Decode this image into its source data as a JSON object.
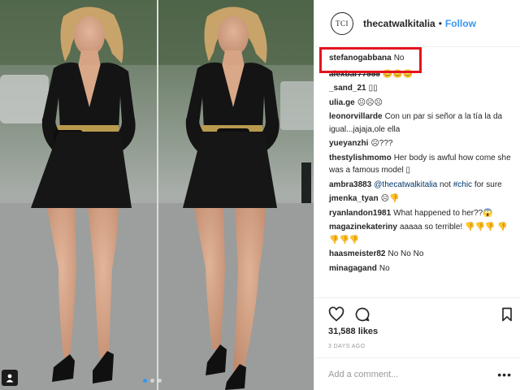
{
  "post": {
    "account": {
      "avatar_text": "TCI",
      "username": "thecatwalkitalia",
      "separator": "•",
      "follow_label": "Follow"
    },
    "comments": [
      {
        "user": "stefanogabbana",
        "text": "No",
        "highlighted": true
      },
      {
        "user": "alexbar77555",
        "text": "😊😊😊",
        "obscured": true
      },
      {
        "user": "_sand_21",
        "text": "▯▯"
      },
      {
        "user": "ulia.ge",
        "text": "☹☹☹"
      },
      {
        "user": "leonorvillarde",
        "text": "Con un par si señor a la tía la da igual...jajaja,ole ella"
      },
      {
        "user": "yueyanzhi",
        "text": "☹???"
      },
      {
        "user": "thestylishmomo",
        "text": "Her body is awful how come she was a famous model ▯"
      },
      {
        "user": "ambra3883",
        "mention": "@thecatwalkitalia",
        "text": "not",
        "hashtag": "#chic",
        "text_after": "for sure"
      },
      {
        "user": "jmenka_tyan",
        "text": "☹👎"
      },
      {
        "user": "ryanlandon1981",
        "text": "What happened to her??😱"
      },
      {
        "user": "magazinekateriny",
        "text": "aaaaa so terrible! 👎👎👎 👎👎👎👎"
      },
      {
        "user": "haasmeister82",
        "text": "No No No"
      },
      {
        "user": "minagagand",
        "text": "No"
      }
    ],
    "actions": {
      "like_icon": "heart-icon",
      "comment_icon": "comment-bubble-icon",
      "save_icon": "bookmark-icon"
    },
    "likes": "31,588 likes",
    "posted": "3 DAYS AGO",
    "add_comment_placeholder": "Add a comment...",
    "more_label": "•••",
    "carousel_dots": 3,
    "colors": {
      "link": "#3897f0",
      "highlight": "#e3141d",
      "dress": "#141414"
    }
  }
}
